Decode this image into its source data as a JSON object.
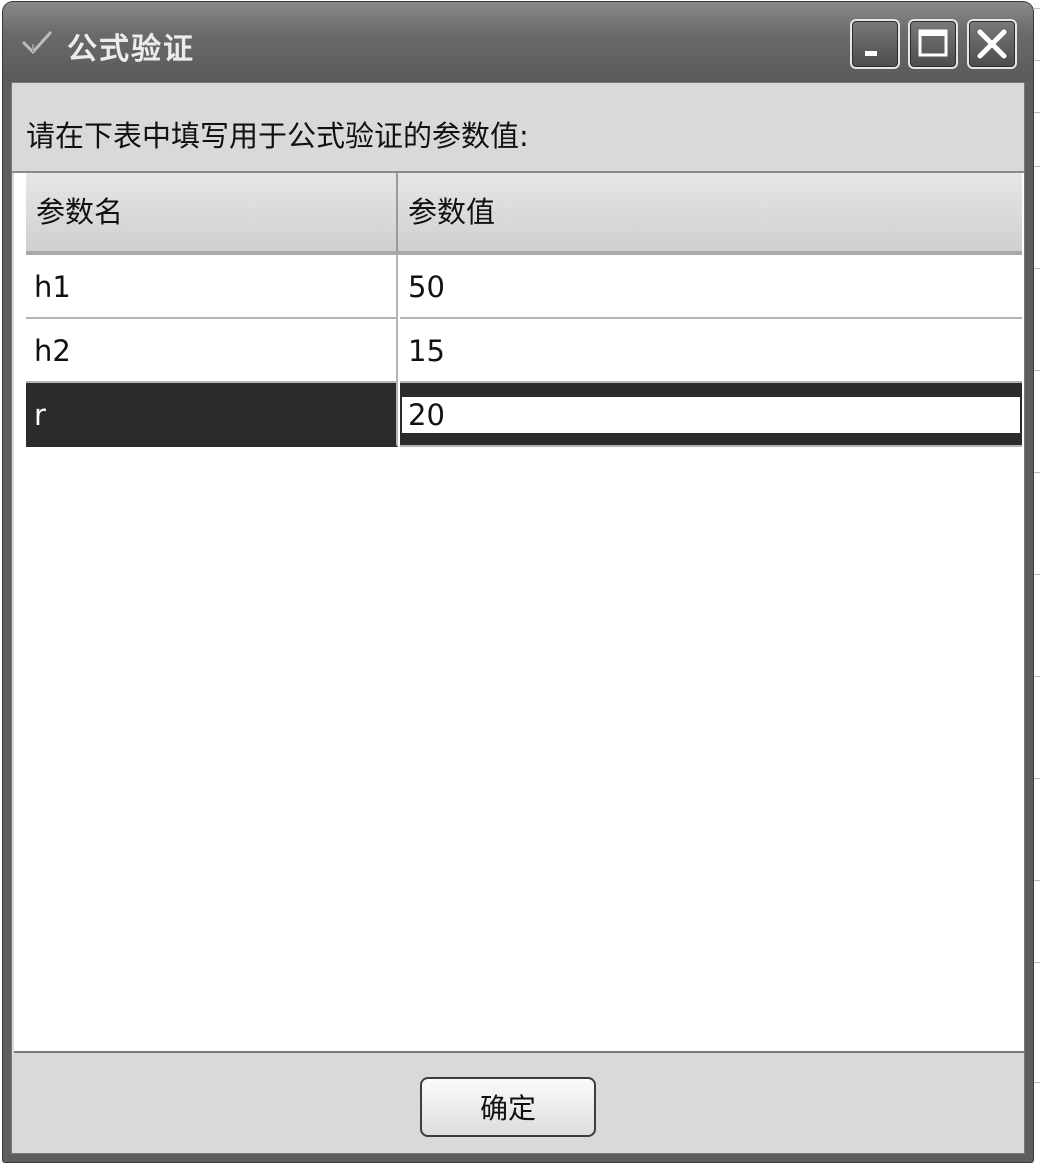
{
  "window": {
    "title": "公式验证",
    "app_icon": "checkmark-icon",
    "controls": {
      "minimize": "minimize-icon",
      "maximize": "maximize-icon",
      "close": "close-icon"
    }
  },
  "prompt": "请在下表中填写用于公式验证的参数值:",
  "table": {
    "headers": [
      "参数名",
      "参数值"
    ],
    "rows": [
      {
        "name": "h1",
        "value": "50"
      },
      {
        "name": "h2",
        "value": "15"
      },
      {
        "name": "r",
        "value": "20"
      }
    ],
    "selected_row": 2
  },
  "footer": {
    "ok_label": "确定"
  }
}
